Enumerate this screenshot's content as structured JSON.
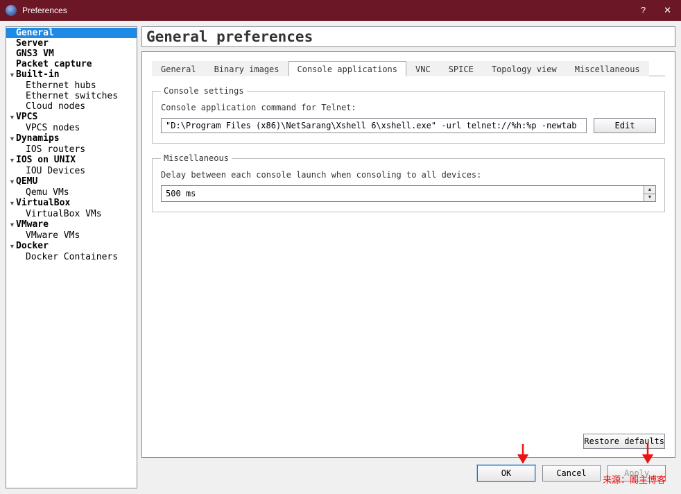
{
  "window": {
    "title": "Preferences"
  },
  "sidebar": {
    "items": [
      {
        "label": "General",
        "level": 1,
        "expandable": false,
        "selected": true
      },
      {
        "label": "Server",
        "level": 1,
        "expandable": false
      },
      {
        "label": "GNS3 VM",
        "level": 1,
        "expandable": false
      },
      {
        "label": "Packet capture",
        "level": 1,
        "expandable": false
      },
      {
        "label": "Built-in",
        "level": 1,
        "expandable": true
      },
      {
        "label": "Ethernet hubs",
        "level": 2
      },
      {
        "label": "Ethernet switches",
        "level": 2
      },
      {
        "label": "Cloud nodes",
        "level": 2
      },
      {
        "label": "VPCS",
        "level": 1,
        "expandable": true
      },
      {
        "label": "VPCS nodes",
        "level": 2
      },
      {
        "label": "Dynamips",
        "level": 1,
        "expandable": true
      },
      {
        "label": "IOS routers",
        "level": 2
      },
      {
        "label": "IOS on UNIX",
        "level": 1,
        "expandable": true
      },
      {
        "label": "IOU Devices",
        "level": 2
      },
      {
        "label": "QEMU",
        "level": 1,
        "expandable": true
      },
      {
        "label": "Qemu VMs",
        "level": 2
      },
      {
        "label": "VirtualBox",
        "level": 1,
        "expandable": true
      },
      {
        "label": "VirtualBox VMs",
        "level": 2
      },
      {
        "label": "VMware",
        "level": 1,
        "expandable": true
      },
      {
        "label": "VMware VMs",
        "level": 2
      },
      {
        "label": "Docker",
        "level": 1,
        "expandable": true
      },
      {
        "label": "Docker Containers",
        "level": 2
      }
    ]
  },
  "main": {
    "heading": "General preferences",
    "tabs": [
      {
        "label": "General"
      },
      {
        "label": "Binary images"
      },
      {
        "label": "Console applications",
        "active": true
      },
      {
        "label": "VNC"
      },
      {
        "label": "SPICE"
      },
      {
        "label": "Topology view"
      },
      {
        "label": "Miscellaneous"
      }
    ],
    "console_group": {
      "legend": "Console settings",
      "field_label": "Console application command for Telnet:",
      "command_value": "\"D:\\Program Files (x86)\\NetSarang\\Xshell 6\\xshell.exe\" -url telnet://%h:%p -newtab %d",
      "edit_button": "Edit"
    },
    "misc_group": {
      "legend": "Miscellaneous",
      "field_label": "Delay between each console launch when consoling to all devices:",
      "delay_value": "500 ms"
    },
    "restore_button": "Restore defaults"
  },
  "buttons": {
    "ok": "OK",
    "cancel": "Cancel",
    "apply": "Apply"
  },
  "watermark": "来源：阁主博客"
}
